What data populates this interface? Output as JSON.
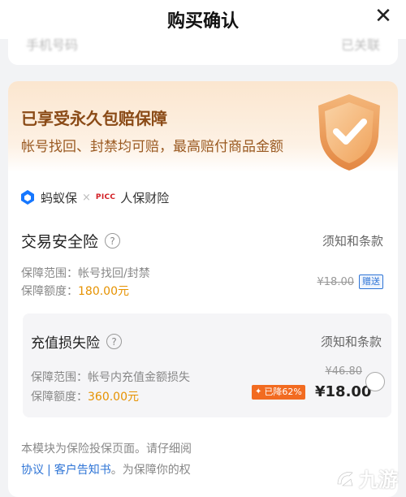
{
  "header": {
    "title": "购买确认",
    "close_glyph": "✕"
  },
  "top_strip": {
    "left_text": "手机号码",
    "right_text": "已关联"
  },
  "banner": {
    "title": "已享受永久包赔保障",
    "subtitle": "帐号找回、封禁均可赔，最高赔付商品金额",
    "icon": "shield-check-icon"
  },
  "insurers": {
    "first": "蚂蚁保",
    "separator": "×",
    "picc_logo": "PICC",
    "second": "人保财险"
  },
  "policy_main": {
    "title": "交易安全险",
    "help": "?",
    "terms": "须知和条款",
    "scope_label": "保障范围：",
    "scope_value": "帐号找回/封禁",
    "amount_label": "保障额度：",
    "amount_value": "180.00元",
    "original_price": "¥18.00",
    "badge": "赠送"
  },
  "policy_topup": {
    "title": "充值损失险",
    "help": "?",
    "terms": "须知和条款",
    "scope_label": "保障范围：",
    "scope_value": "帐号内充值金额损失",
    "amount_label": "保障额度：",
    "amount_value": "360.00元",
    "original_price": "¥46.80",
    "discount": "已降62%",
    "price": "¥18.00"
  },
  "footnote": {
    "line1": "本模块为保险投保页面。请仔细阅",
    "link1": "协议",
    "sep": "|",
    "link2": "客户告知书",
    "line2_rest": "。为保障你的权"
  },
  "watermark": {
    "text": "九游"
  },
  "colors": {
    "accent_orange": "#e69200",
    "link_blue": "#2e74d6",
    "discount": "#f26b21",
    "banner_text": "#8a4a16"
  }
}
